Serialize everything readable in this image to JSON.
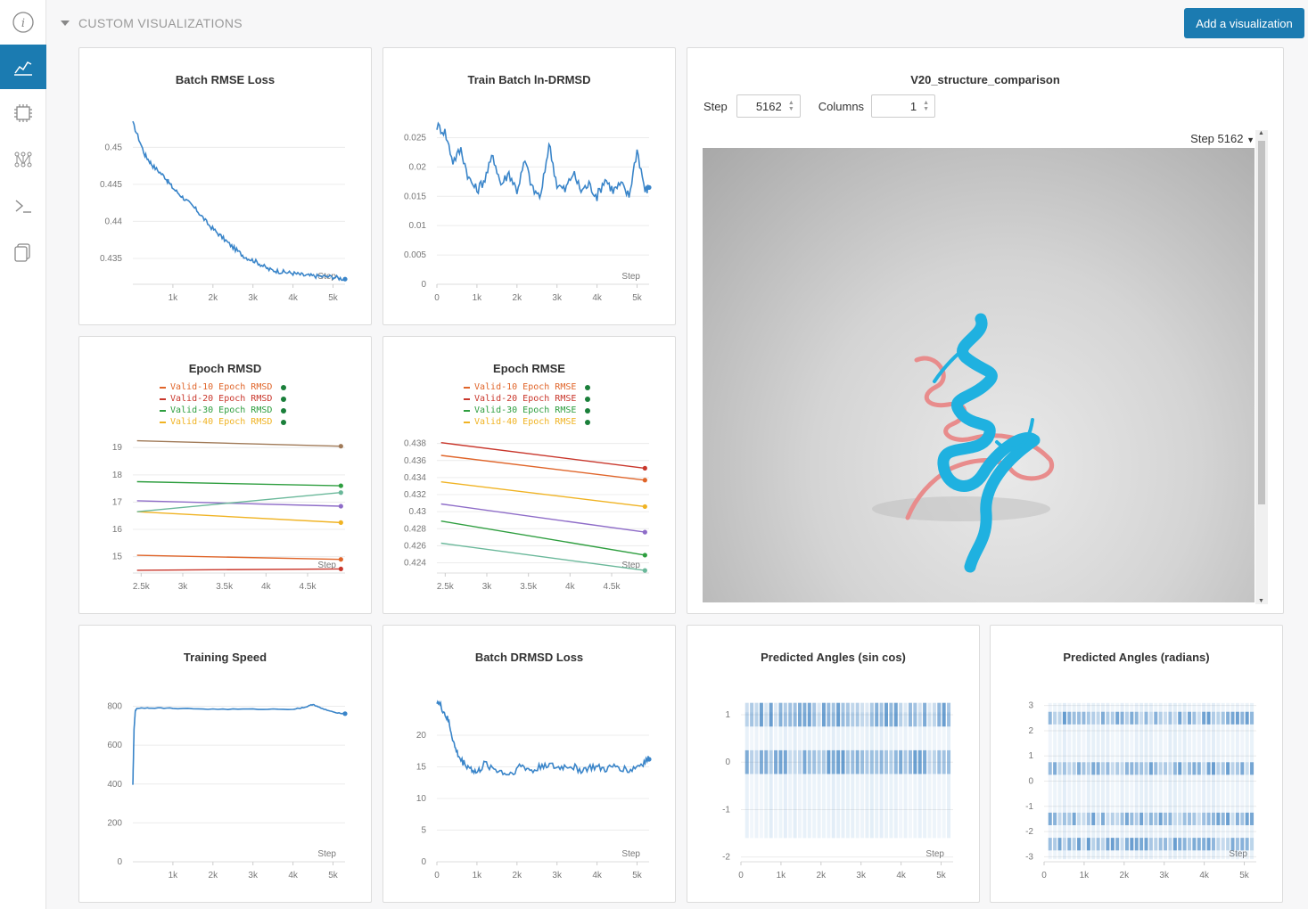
{
  "sidebar": {
    "items": [
      {
        "icon": "info-icon"
      },
      {
        "icon": "chart-icon",
        "active": true
      },
      {
        "icon": "chip-icon"
      },
      {
        "icon": "model-graph-icon"
      },
      {
        "icon": "terminal-icon"
      },
      {
        "icon": "files-icon"
      }
    ]
  },
  "section": {
    "title": "CUSTOM VISUALIZATIONS",
    "add_button": "Add a visualization"
  },
  "colors": {
    "accent": "#1b7bb1",
    "line": "#3a85c9",
    "protein_pred": "#1fb1e0",
    "protein_true": "#e88c8c"
  },
  "panels": {
    "batch_rmse": {
      "title": "Batch RMSE Loss",
      "x_axis_label": "Step"
    },
    "train_ln_drmsd": {
      "title": "Train Batch ln-DRMSD",
      "x_axis_label": "Step"
    },
    "epoch_rmsd": {
      "title": "Epoch RMSD",
      "x_axis_label": "Step",
      "legend": [
        "Valid-10 Epoch RMSD",
        "Valid-20 Epoch RMSD",
        "Valid-30 Epoch RMSD",
        "Valid-40 Epoch RMSD"
      ]
    },
    "epoch_rmse": {
      "title": "Epoch RMSE",
      "x_axis_label": "Step",
      "legend": [
        "Valid-10 Epoch RMSE",
        "Valid-20 Epoch RMSE",
        "Valid-30 Epoch RMSE",
        "Valid-40 Epoch RMSE"
      ]
    },
    "structure": {
      "title": "V20_structure_comparison",
      "step_label": "Step",
      "step_value": "5162",
      "columns_label": "Columns",
      "columns_value": "1",
      "step_selector": "Step 5162"
    },
    "training_speed": {
      "title": "Training Speed",
      "x_axis_label": "Step"
    },
    "batch_drmsd": {
      "title": "Batch DRMSD Loss",
      "x_axis_label": "Step"
    },
    "angles_sincos": {
      "title": "Predicted Angles (sin cos)",
      "x_axis_label": "Step"
    },
    "angles_rad": {
      "title": "Predicted Angles (radians)",
      "x_axis_label": "Step"
    }
  },
  "chart_data": [
    {
      "id": "batch_rmse",
      "type": "line",
      "title": "Batch RMSE Loss",
      "xlabel": "Step",
      "xlim": [
        0,
        5300
      ],
      "ylim": [
        0.4315,
        0.4533
      ],
      "x_ticks": [
        "1k",
        "2k",
        "3k",
        "4k",
        "5k"
      ],
      "x_tick_values": [
        1000,
        2000,
        3000,
        4000,
        5000
      ],
      "y_ticks": [
        "0.435",
        "0.44",
        "0.445",
        "0.45"
      ],
      "y_tick_values": [
        0.435,
        0.44,
        0.445,
        0.45
      ],
      "series": [
        {
          "x": [
            0,
            300,
            500,
            800,
            1000,
            1300,
            1600,
            1900,
            2200,
            2500,
            2800,
            3100,
            3400,
            3700,
            4000,
            4300,
            4600,
            5000,
            5300
          ],
          "y": [
            0.4533,
            0.449,
            0.4475,
            0.446,
            0.4445,
            0.443,
            0.4415,
            0.4395,
            0.438,
            0.4365,
            0.4352,
            0.4345,
            0.4335,
            0.4332,
            0.433,
            0.4327,
            0.4326,
            0.4325,
            0.4322
          ]
        }
      ]
    },
    {
      "id": "train_ln_drmsd",
      "type": "line",
      "title": "Train Batch ln-DRMSD",
      "xlabel": "Step",
      "xlim": [
        0,
        5300
      ],
      "ylim": [
        0,
        0.0275
      ],
      "x_ticks": [
        "0",
        "1k",
        "2k",
        "3k",
        "4k",
        "5k"
      ],
      "x_tick_values": [
        0,
        1000,
        2000,
        3000,
        4000,
        5000
      ],
      "y_ticks": [
        "0",
        "0.005",
        "0.01",
        "0.015",
        "0.02",
        "0.025"
      ],
      "y_tick_values": [
        0,
        0.005,
        0.01,
        0.015,
        0.02,
        0.025
      ],
      "series": [
        {
          "x": [
            0,
            200,
            400,
            600,
            800,
            1000,
            1200,
            1400,
            1600,
            1800,
            2000,
            2200,
            2400,
            2600,
            2800,
            3000,
            3200,
            3400,
            3600,
            3800,
            4000,
            4200,
            4400,
            4600,
            4800,
            5000,
            5200,
            5300
          ],
          "y": [
            0.027,
            0.026,
            0.021,
            0.023,
            0.018,
            0.016,
            0.018,
            0.022,
            0.017,
            0.019,
            0.016,
            0.021,
            0.016,
            0.015,
            0.024,
            0.017,
            0.016,
            0.019,
            0.016,
            0.017,
            0.015,
            0.018,
            0.016,
            0.017,
            0.015,
            0.023,
            0.016,
            0.0165
          ]
        }
      ]
    },
    {
      "id": "epoch_rmsd",
      "type": "line",
      "title": "Epoch RMSD",
      "xlabel": "Step",
      "xlim": [
        2400,
        4950
      ],
      "ylim": [
        14.4,
        19.4
      ],
      "x_ticks": [
        "2.5k",
        "3k",
        "3.5k",
        "4k",
        "4.5k"
      ],
      "x_tick_values": [
        2500,
        3000,
        3500,
        4000,
        4500
      ],
      "y_ticks": [
        "15",
        "16",
        "17",
        "18",
        "19"
      ],
      "y_tick_values": [
        15,
        16,
        17,
        18,
        19
      ],
      "series": [
        {
          "name": "Valid-10 Epoch RMSD",
          "color": "#e0652a",
          "x": [
            2450,
            4900
          ],
          "y": [
            15.05,
            14.9
          ]
        },
        {
          "name": "Valid-20 Epoch RMSD",
          "color": "#c9372c",
          "x": [
            2450,
            4900
          ],
          "y": [
            14.5,
            14.55
          ]
        },
        {
          "name": "Valid-30 Epoch RMSD",
          "color": "#2e9e3f",
          "x": [
            2450,
            4900
          ],
          "y": [
            17.75,
            17.6
          ]
        },
        {
          "name": "Valid-40 Epoch RMSD",
          "color": "#f0b323",
          "x": [
            2450,
            4900
          ],
          "y": [
            16.65,
            16.25
          ]
        },
        {
          "color": "#a07a58",
          "x": [
            2450,
            4900
          ],
          "y": [
            19.25,
            19.05
          ]
        },
        {
          "color": "#8e6cc8",
          "x": [
            2450,
            4900
          ],
          "y": [
            17.05,
            16.85
          ]
        },
        {
          "color": "#6ab89a",
          "x": [
            2450,
            4900
          ],
          "y": [
            16.65,
            17.35
          ]
        }
      ]
    },
    {
      "id": "epoch_rmse",
      "type": "line",
      "title": "Epoch RMSE",
      "xlabel": "Step",
      "xlim": [
        2400,
        4950
      ],
      "ylim": [
        0.4228,
        0.4388
      ],
      "x_ticks": [
        "2.5k",
        "3k",
        "3.5k",
        "4k",
        "4.5k"
      ],
      "x_tick_values": [
        2500,
        3000,
        3500,
        4000,
        4500
      ],
      "y_ticks": [
        "0.424",
        "0.426",
        "0.428",
        "0.43",
        "0.432",
        "0.434",
        "0.436",
        "0.438"
      ],
      "y_tick_values": [
        0.424,
        0.426,
        0.428,
        0.43,
        0.432,
        0.434,
        0.436,
        0.438
      ],
      "series": [
        {
          "name": "Valid-10 Epoch RMSE",
          "color": "#e0652a",
          "x": [
            2450,
            4900
          ],
          "y": [
            0.4366,
            0.4337
          ]
        },
        {
          "name": "Valid-20 Epoch RMSE",
          "color": "#c9372c",
          "x": [
            2450,
            4900
          ],
          "y": [
            0.4381,
            0.4351
          ]
        },
        {
          "name": "Valid-30 Epoch RMSE",
          "color": "#2e9e3f",
          "x": [
            2450,
            4900
          ],
          "y": [
            0.4289,
            0.4249
          ]
        },
        {
          "name": "Valid-40 Epoch RMSE",
          "color": "#f0b323",
          "x": [
            2450,
            4900
          ],
          "y": [
            0.4335,
            0.4306
          ]
        },
        {
          "color": "#8e6cc8",
          "x": [
            2450,
            4900
          ],
          "y": [
            0.4309,
            0.4276
          ]
        },
        {
          "color": "#6ab89a",
          "x": [
            2450,
            4900
          ],
          "y": [
            0.4263,
            0.4231
          ]
        }
      ]
    },
    {
      "id": "training_speed",
      "type": "line",
      "title": "Training Speed",
      "xlabel": "Step",
      "xlim": [
        0,
        5300
      ],
      "ylim": [
        0,
        830
      ],
      "x_ticks": [
        "1k",
        "2k",
        "3k",
        "4k",
        "5k"
      ],
      "x_tick_values": [
        1000,
        2000,
        3000,
        4000,
        5000
      ],
      "y_ticks": [
        "0",
        "200",
        "400",
        "600",
        "800"
      ],
      "y_tick_values": [
        0,
        200,
        400,
        600,
        800
      ],
      "series": [
        {
          "x": [
            0,
            30,
            60,
            100,
            400,
            1000,
            2000,
            3000,
            4000,
            4300,
            4500,
            4700,
            5000,
            5300
          ],
          "y": [
            395,
            680,
            775,
            790,
            792,
            790,
            785,
            785,
            785,
            795,
            810,
            790,
            770,
            762
          ]
        }
      ]
    },
    {
      "id": "batch_drmsd",
      "type": "line",
      "title": "Batch DRMSD Loss",
      "xlabel": "Step",
      "xlim": [
        0,
        5300
      ],
      "ylim": [
        0,
        25.5
      ],
      "x_ticks": [
        "0",
        "1k",
        "2k",
        "3k",
        "4k",
        "5k"
      ],
      "x_tick_values": [
        0,
        1000,
        2000,
        3000,
        4000,
        5000
      ],
      "y_ticks": [
        "0",
        "5",
        "10",
        "15",
        "20"
      ],
      "y_tick_values": [
        0,
        5,
        10,
        15,
        20
      ],
      "series": [
        {
          "x": [
            0,
            150,
            300,
            450,
            600,
            800,
            1000,
            1200,
            1500,
            1800,
            2100,
            2400,
            2700,
            3000,
            3300,
            3600,
            3900,
            4200,
            4500,
            4800,
            5100,
            5300
          ],
          "y": [
            25.5,
            24,
            22,
            18,
            16,
            15,
            14,
            15.5,
            14.5,
            13.8,
            15.2,
            14.3,
            15.5,
            14.8,
            15.2,
            14.5,
            15,
            14.6,
            15.1,
            14.4,
            15.4,
            16.2
          ]
        }
      ]
    },
    {
      "id": "angles_sincos",
      "type": "heatmap",
      "title": "Predicted Angles (sin cos)",
      "xlabel": "Step",
      "xlim": [
        0,
        5300
      ],
      "ylim": [
        -2.1,
        1.3
      ],
      "x_ticks": [
        "0",
        "1k",
        "2k",
        "3k",
        "4k",
        "5k"
      ],
      "x_tick_values": [
        0,
        1000,
        2000,
        3000,
        4000,
        5000
      ],
      "y_ticks": [
        "-2",
        "-1",
        "0",
        "1"
      ],
      "y_tick_values": [
        -2,
        -1,
        0,
        1
      ]
    },
    {
      "id": "angles_rad",
      "type": "heatmap",
      "title": "Predicted Angles (radians)",
      "xlabel": "Step",
      "xlim": [
        0,
        5300
      ],
      "ylim": [
        -3.2,
        3.2
      ],
      "x_ticks": [
        "0",
        "1k",
        "2k",
        "3k",
        "4k",
        "5k"
      ],
      "x_tick_values": [
        0,
        1000,
        2000,
        3000,
        4000,
        5000
      ],
      "y_ticks": [
        "-3",
        "-2",
        "-1",
        "0",
        "1",
        "2",
        "3"
      ],
      "y_tick_values": [
        -3,
        -2,
        -1,
        0,
        1,
        2,
        3
      ]
    }
  ]
}
